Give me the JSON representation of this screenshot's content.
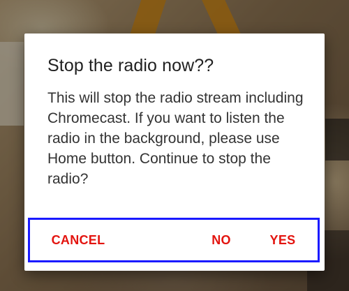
{
  "dialog": {
    "title": "Stop the radio now??",
    "message": "This will stop the radio stream including Chromecast. If you want to listen the radio in the background, please use Home button. Continue to stop the radio?",
    "buttons": {
      "cancel_label": "CANCEL",
      "no_label": "NO",
      "yes_label": "YES"
    },
    "button_color": "#e3140f",
    "highlight_border_color": "#1a1aff"
  }
}
